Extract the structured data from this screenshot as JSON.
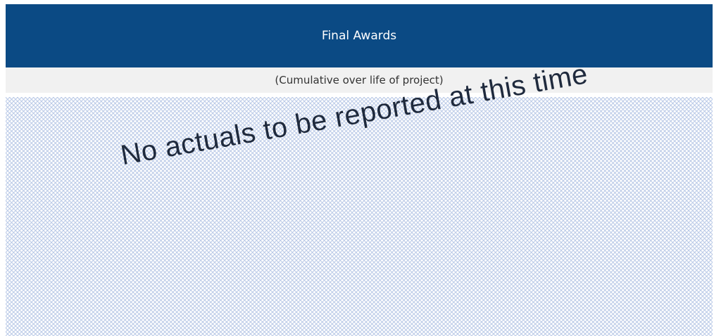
{
  "header": {
    "title": "Final Awards",
    "background_color": "#0b4a84"
  },
  "subheader": {
    "text": "(Cumulative over life of project)"
  },
  "body": {
    "message": "No actuals to be reported at this time",
    "pattern_color": "#b8c8e6"
  }
}
